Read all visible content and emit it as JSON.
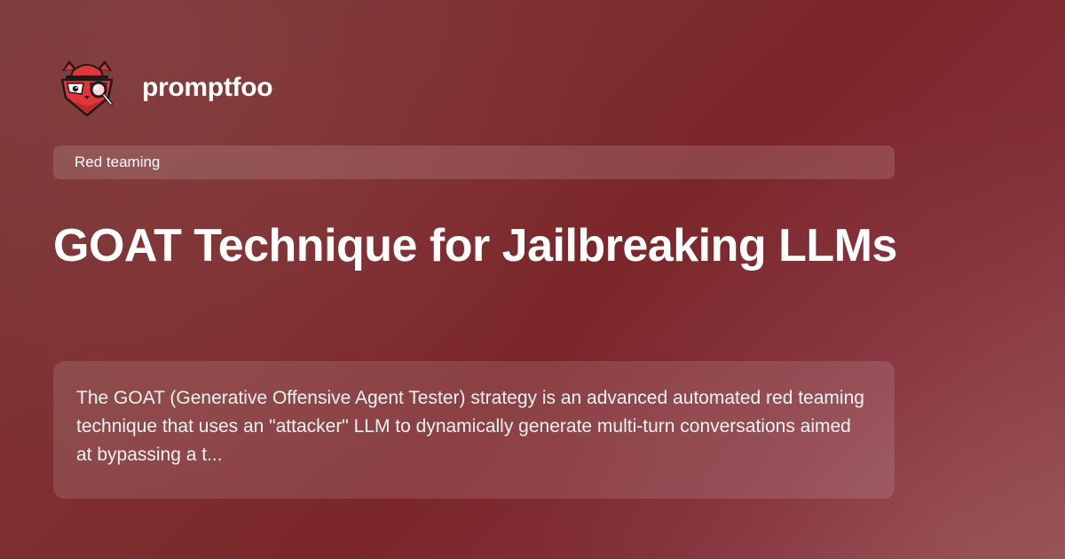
{
  "brand": {
    "name": "promptfoo",
    "logo_icon": "red-panda-detective-icon"
  },
  "category": {
    "label": "Red teaming"
  },
  "article": {
    "title": "GOAT Technique for Jailbreaking LLMs",
    "description": "The GOAT (Generative Offensive Agent Tester) strategy is an advanced automated red teaming technique that uses an \"attacker\" LLM to dynamically generate multi-turn conversations aimed at bypassing a t..."
  },
  "colors": {
    "background": "#7e2d2f",
    "logo_red": "#e0363a",
    "logo_dark": "#1e1a1a",
    "text": "#ffffff"
  }
}
